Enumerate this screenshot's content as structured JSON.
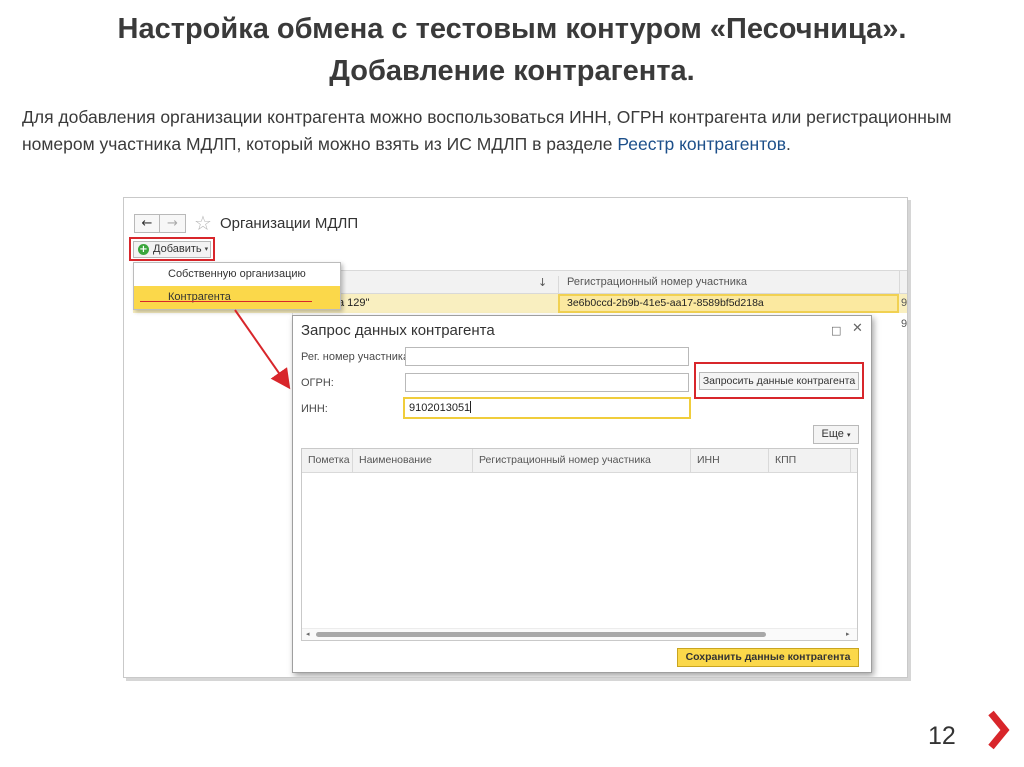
{
  "slide": {
    "title_line1": "Настройка обмена с тестовым контуром «Песочница».",
    "title_line2": "Добавление контрагента.",
    "paragraph_main": "Для добавления организации контрагента можно воспользоваться ИНН, ОГРН контрагента или регистрационным номером участника МДЛП, который можно взять из ИС МДЛП в разделе ",
    "paragraph_link": "Реестр контрагентов",
    "paragraph_end": ".",
    "page_number": "12",
    "next_icon": "chevron-right-icon",
    "accent_color": "#d8262b"
  },
  "window": {
    "back_icon": "←",
    "forward_icon": "→",
    "favorite_icon": "☆",
    "title": "Организации МДЛП",
    "add_button": "Добавить",
    "add_icon": "+",
    "dropdown_icon": "▾",
    "dropdown_items": [
      "Собственную организацию",
      "Контрагента"
    ],
    "table_columns": {
      "sort_icon": "↓",
      "reg_number": "Регистрационный номер участника"
    },
    "selected_row": {
      "name": "а 129\"",
      "reg_number": "3e6b0ccd-2b9b-41e5-aa17-8589bf5d218a",
      "more": "9"
    },
    "second_row_more": "9"
  },
  "dialog": {
    "title": "Запрос данных контрагента",
    "maximize_icon": "□",
    "close_icon": "✕",
    "fields": [
      {
        "label": "Рег. номер участника:",
        "value": ""
      },
      {
        "label": "ОГРН:",
        "value": ""
      },
      {
        "label": "ИНН:",
        "value": "9102013051"
      }
    ],
    "request_button": "Запросить данные контрагента",
    "more_button": "Еще",
    "more_icon": "▾",
    "grid_columns": [
      "Пометка",
      "Наименование",
      "Регистрационный номер участника",
      "ИНН",
      "КПП"
    ],
    "scroll_left_icon": "◂",
    "scroll_right_icon": "▸",
    "save_button": "Сохранить данные контрагента",
    "highlight_color": "#fbd84a"
  }
}
